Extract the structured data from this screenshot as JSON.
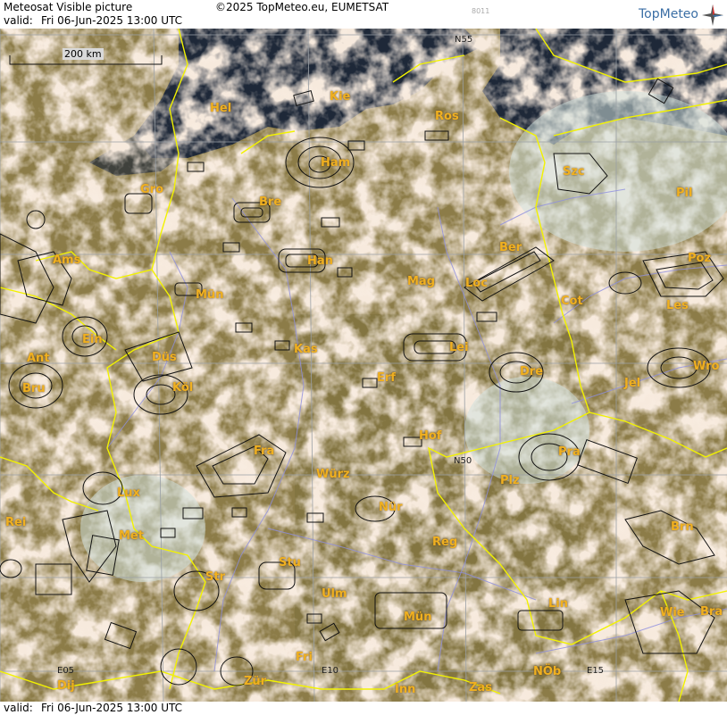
{
  "header": {
    "title": "Meteosat Visible picture",
    "copyright": "©2025 TopMeteo.eu, EUMETSAT",
    "code": "8011",
    "valid_label": "valid:",
    "valid_time": "Fri   06-Jun-2025  13:00 UTC",
    "logo_text": "TopMeteo"
  },
  "footer": {
    "valid_label": "valid:",
    "valid_time": "Fri   06-Jun-2025  13:00 UTC"
  },
  "scale": {
    "label": "200 km"
  },
  "colors": {
    "city_label": "#f0b020",
    "borders": "#f2f200",
    "rivers": "#8f8fe0",
    "grid": "#9aa0a6",
    "land": "#8a7a45",
    "sea": "#1f2a3a",
    "cloud": "#e8d0b8"
  },
  "grid_labels": [
    "N55",
    "N50",
    "E05",
    "E10",
    "E15"
  ],
  "cities": [
    "Hel",
    "Kie",
    "Ros",
    "Ham",
    "Szc",
    "Gro",
    "Bre",
    "Pil",
    "Ber",
    "Poz",
    "Ams",
    "Han",
    "Mag",
    "Loc",
    "Mün",
    "Cot",
    "Les",
    "Ein",
    "Kas",
    "Lei",
    "Ant",
    "Düs",
    "Wro",
    "Köl",
    "Erf",
    "Dre",
    "Jel",
    "Bru",
    "Hof",
    "Fra",
    "Pra",
    "Lux",
    "Würz",
    "Plz",
    "Nür",
    "Rei",
    "Met",
    "Reg",
    "Brn",
    "Stu",
    "Str",
    "Ulm",
    "Mün",
    "Lin",
    "Wie",
    "Bra",
    "Fri",
    "Dij",
    "Zür",
    "Inn",
    "Zas",
    "NÖb"
  ]
}
